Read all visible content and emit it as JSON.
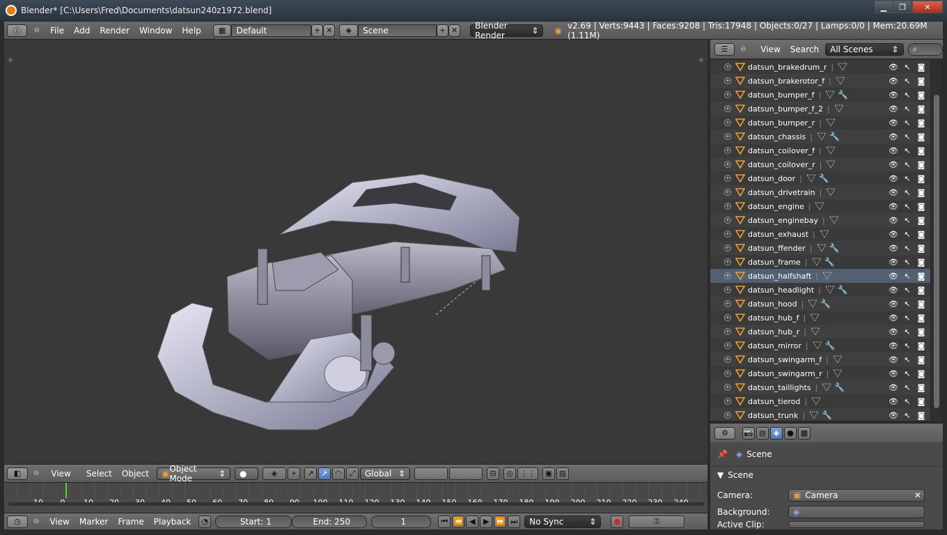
{
  "window": {
    "title": "Blender* [C:\\Users\\Fred\\Documents\\datsun240z1972.blend]",
    "min": "▁",
    "max": "❐",
    "close": "✕"
  },
  "top_menu": {
    "items": [
      "File",
      "Add",
      "Render",
      "Window",
      "Help"
    ]
  },
  "screen_layout": {
    "value": "Default"
  },
  "scene_selector": {
    "value": "Scene"
  },
  "render_engine": {
    "value": "Blender Render"
  },
  "stats": "v2.69 | Verts:9443 | Faces:9208 | Tris:17948 | Objects:0/27 | Lamps:0/0 | Mem:20.69M (1.11M)",
  "outliner": {
    "menu": [
      "View",
      "Search"
    ],
    "filter": "All Scenes",
    "items": [
      {
        "name": "datsun_brakedrum_r",
        "mod": false
      },
      {
        "name": "datsun_brakerotor_f",
        "mod": false
      },
      {
        "name": "datsun_bumper_f",
        "mod": true
      },
      {
        "name": "datsun_bumper_f_2",
        "mod": false
      },
      {
        "name": "datsun_bumper_r",
        "mod": false
      },
      {
        "name": "datsun_chassis",
        "mod": true
      },
      {
        "name": "datsun_coilover_f",
        "mod": false
      },
      {
        "name": "datsun_coilover_r",
        "mod": false
      },
      {
        "name": "datsun_door",
        "mod": true
      },
      {
        "name": "datsun_drivetrain",
        "mod": false
      },
      {
        "name": "datsun_engine",
        "mod": false
      },
      {
        "name": "datsun_enginebay",
        "mod": false
      },
      {
        "name": "datsun_exhaust",
        "mod": false
      },
      {
        "name": "datsun_ffender",
        "mod": true
      },
      {
        "name": "datsun_frame",
        "mod": true
      },
      {
        "name": "datsun_halfshaft",
        "mod": false
      },
      {
        "name": "datsun_headlight",
        "mod": true
      },
      {
        "name": "datsun_hood",
        "mod": true
      },
      {
        "name": "datsun_hub_f",
        "mod": false
      },
      {
        "name": "datsun_hub_r",
        "mod": false
      },
      {
        "name": "datsun_mirror",
        "mod": true
      },
      {
        "name": "datsun_swingarm_f",
        "mod": false
      },
      {
        "name": "datsun_swingarm_r",
        "mod": false
      },
      {
        "name": "datsun_taillights",
        "mod": true
      },
      {
        "name": "datsun_tierod",
        "mod": false
      },
      {
        "name": "datsun_trunk",
        "mod": true
      }
    ]
  },
  "viewport_footer": {
    "menu": [
      "View",
      "Select",
      "Object"
    ],
    "mode": "Object Mode",
    "orientation": "Global"
  },
  "timeline": {
    "ticks": [
      "-10",
      "0",
      "10",
      "20",
      "30",
      "40",
      "50",
      "60",
      "70",
      "80",
      "90",
      "100",
      "110",
      "120",
      "130",
      "140",
      "150",
      "160",
      "170",
      "180",
      "190",
      "200",
      "210",
      "220",
      "230",
      "240"
    ]
  },
  "timeline_footer": {
    "menu": [
      "View",
      "Marker",
      "Frame",
      "Playback"
    ],
    "start": "Start: 1",
    "end": "End: 250",
    "current": "1",
    "sync": "No Sync"
  },
  "properties": {
    "breadcrumb": "Scene",
    "panel": "Scene",
    "camera_label": "Camera:",
    "camera_value": "Camera",
    "background_label": "Background:",
    "active_clip_label": "Active Clip:"
  }
}
